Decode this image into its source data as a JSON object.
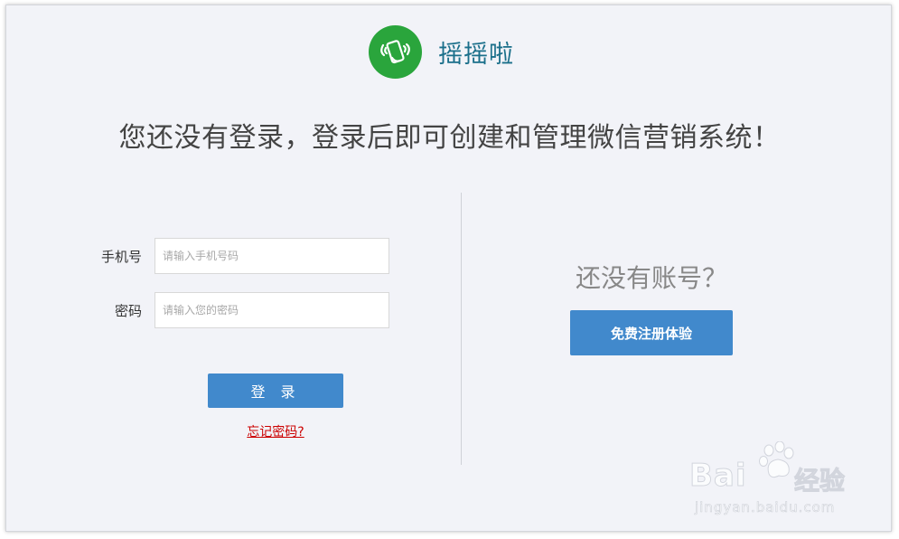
{
  "brand": {
    "name": "摇摇啦",
    "logo_icon": "phone-shake-icon",
    "logo_color": "#2aa53c"
  },
  "headline": "您还没有登录，登录后即可创建和管理微信营销系统！",
  "login_form": {
    "phone_label": "手机号",
    "phone_placeholder": "请输入手机号码",
    "password_label": "密码",
    "password_placeholder": "请输入您的密码",
    "submit_label": "登 录",
    "forgot_label": "忘记密码?"
  },
  "register": {
    "prompt": "还没有账号？",
    "button_label": "免费注册体验"
  },
  "watermark": {
    "logo_text": "Bai",
    "logo_text2": "经验",
    "url": "jingyan.baidu.com"
  },
  "colors": {
    "accent": "#4189cc",
    "background": "#f2f3f8",
    "link": "#cc0000"
  }
}
